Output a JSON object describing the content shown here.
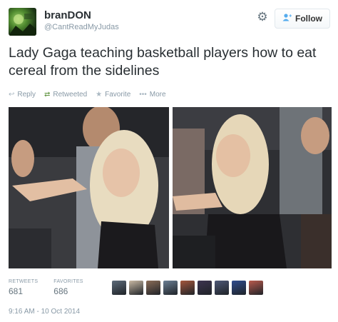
{
  "header": {
    "display_name": "branDON",
    "handle": "@CantReadMyJudas",
    "follow_label": "Follow",
    "follow_icon": "person-plus-icon",
    "settings_icon": "gear-icon"
  },
  "tweet": {
    "text": "Lady Gaga teaching basketball players how to eat cereal from the sidelines"
  },
  "actions": {
    "reply_label": "Reply",
    "retweeted_label": "Retweeted",
    "favorite_label": "Favorite",
    "more_label": "More"
  },
  "stats": {
    "retweets_label": "RETWEETS",
    "retweets_value": "681",
    "favorites_label": "FAVORITES",
    "favorites_value": "686"
  },
  "favoriters": [
    {
      "color": "#5d6b7a"
    },
    {
      "color": "#c9b9a4"
    },
    {
      "color": "#8b6d57"
    },
    {
      "color": "#6b7f94"
    },
    {
      "color": "#a4563d"
    },
    {
      "color": "#3d3450"
    },
    {
      "color": "#4e5878"
    },
    {
      "color": "#2f4c8f"
    },
    {
      "color": "#b85a4d"
    }
  ],
  "timestamp": "9:16 AM - 10 Oct 2014",
  "colors": {
    "link_blue": "#55acee",
    "muted_gray": "#8899a6",
    "text_dark": "#292f33"
  }
}
